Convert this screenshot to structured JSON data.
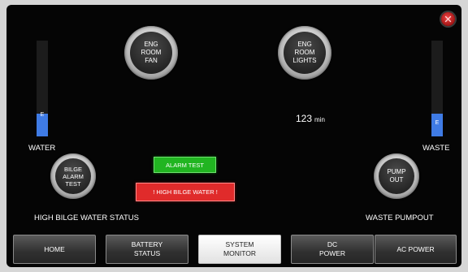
{
  "tanks": {
    "water": {
      "label": "WATER",
      "level_letter": "E",
      "fill_fraction": 0.24
    },
    "waste": {
      "label": "WASTE",
      "level_letter": "E",
      "fill_fraction": 0.24
    }
  },
  "buttons": {
    "eng_room_fan": "ENG\nROOM\nFAN",
    "eng_room_lights": "ENG\nROOM\nLIGHTS",
    "bilge_alarm_test": "BILGE\nALARM\nTEST",
    "pump_out": "PUMP\nOUT"
  },
  "timer": {
    "value": "123",
    "unit": "min"
  },
  "alarms": {
    "alarm_test": "ALARM TEST",
    "high_bilge_water": "! HIGH BILGE WATER !"
  },
  "labels": {
    "high_bilge_water_status": "HIGH BILGE WATER STATUS",
    "waste_pumpout": "WASTE PUMPOUT"
  },
  "nav": [
    {
      "label": "HOME",
      "active": false
    },
    {
      "label": "BATTERY\nSTATUS",
      "active": false
    },
    {
      "label": "SYSTEM\nMONITOR",
      "active": true
    },
    {
      "label": "DC\nPOWER",
      "active": false
    },
    {
      "label": "AC POWER",
      "active": false
    }
  ],
  "icons": {
    "close": "close-icon"
  },
  "colors": {
    "tank_fill": "#3f7be5",
    "alarm_test": "#21b521",
    "alarm_high": "#e02b2b",
    "close": "#c81e1e"
  }
}
